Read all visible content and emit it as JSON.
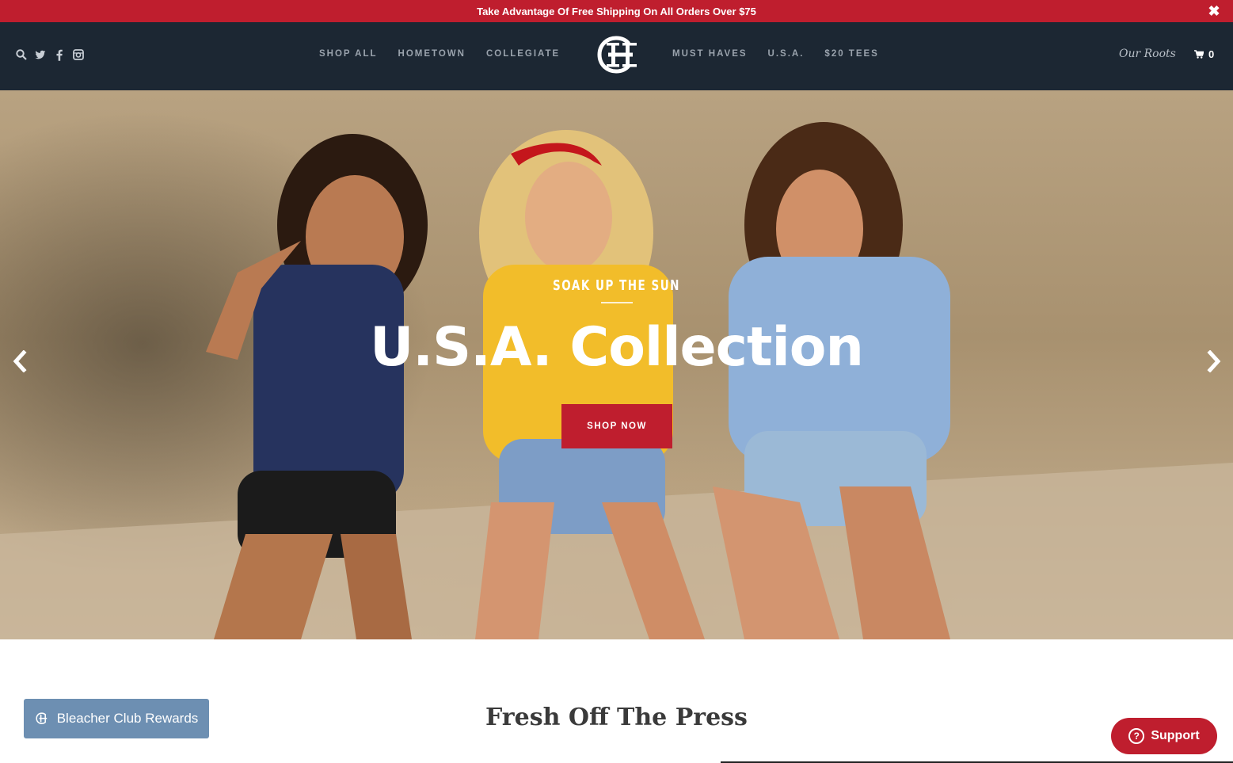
{
  "announcement": {
    "text": "Take Advantage Of Free Shipping On All Orders Over $75",
    "close_icon": "✖"
  },
  "header": {
    "nav_left": [
      "SHOP ALL",
      "HOMETOWN",
      "COLLEGIATE"
    ],
    "nav_right": [
      "MUST HAVES",
      "U.S.A.",
      "$20 TEES"
    ],
    "roots_link": "Our Roots",
    "cart_count": "0",
    "icons": [
      "search-icon",
      "twitter-icon",
      "facebook-icon",
      "instagram-icon",
      "cart-icon"
    ]
  },
  "hero": {
    "kicker": "SOAK UP THE SUN",
    "headline": "U.S.A. Collection",
    "cta": "SHOP NOW"
  },
  "section": {
    "title": "Fresh Off The Press"
  },
  "widgets": {
    "rewards_label": "Bleacher Club Rewards",
    "support_label": "Support",
    "support_icon_glyph": "?"
  },
  "colors": {
    "brand_red": "#bf1e2e",
    "header_navy": "#1c2733",
    "rewards_blue": "#6d8fb2"
  }
}
